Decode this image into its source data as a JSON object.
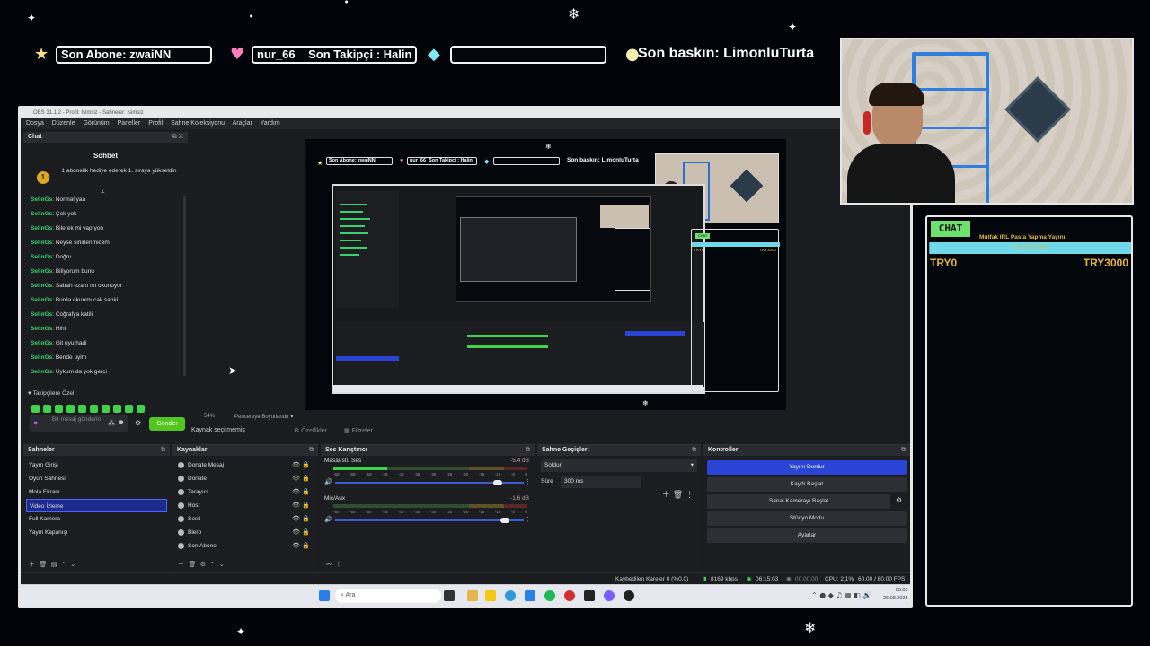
{
  "overlay": {
    "last_sub": "Son Abone: zwaiNN",
    "follower_prefix": "nur_66",
    "last_follower": "Son Takipçi : Halin",
    "empty_pill": "",
    "last_raid": "Son baskın: LimonluTurta"
  },
  "obs": {
    "title": "OBS 31.1.2 - Profil: İsimsiz - Sahneler: İsimsiz",
    "menu": [
      "Dosya",
      "Düzenle",
      "Görünüm",
      "Paneller",
      "Profil",
      "Sahne Koleksiyonu",
      "Araçlar",
      "Yardım"
    ],
    "chat_dock_title": "Chat",
    "chat_header": "Sohbet",
    "sub_banner": "1 abonelik hediye ederek 1. sıraya yükseldin",
    "chat_messages": [
      {
        "user": "SelinGs",
        "text": "Normal yaa"
      },
      {
        "user": "SelinGs",
        "text": "Çok yok"
      },
      {
        "user": "SelinGs",
        "text": "Bilerek mi yapıyon"
      },
      {
        "user": "SelinGs",
        "text": "Neyse sinirlenmicem"
      },
      {
        "user": "SelinGs",
        "text": "Doğru"
      },
      {
        "user": "SelinGs",
        "text": "Biliyorum bunu"
      },
      {
        "user": "SelinGs",
        "text": "Sabah ezanı mı okunuyor"
      },
      {
        "user": "SelinGs",
        "text": "Burda okunmucak sanki"
      },
      {
        "user": "SelinGs",
        "text": "Coğrafya katili"
      },
      {
        "user": "SelinGs",
        "text": "Hihii"
      },
      {
        "user": "SelinGs",
        "text": "Git uyu hadi"
      },
      {
        "user": "SelinGs",
        "text": "Bende uylm"
      },
      {
        "user": "SelinGs",
        "text": "Uykum da yok gerci"
      }
    ],
    "followers_only": "Takipçilere Özel",
    "message_placeholder": "Bir mesaj gönderin",
    "send_label": "Gönder",
    "zoom": "54%",
    "fit_label": "Pencereye Boyutlandır",
    "no_source": "Kaynak seçilmemiş",
    "properties": "Özellikler",
    "filters": "Filtreler",
    "scenes_title": "Sahneler",
    "scenes": [
      "Yayın Girişi",
      "Oyun Sahnesi",
      "Mola Ekranı",
      "Video İzleme",
      "Full Kamera",
      "Yayın Kapanışı"
    ],
    "selected_scene_index": 3,
    "sources_title": "Kaynaklar",
    "sources": [
      "Donate Mesaj",
      "Donate",
      "Tarayıcı",
      "Host",
      "Sesli",
      "Blerp",
      "Son Abone"
    ],
    "mixer_title": "Ses Karıştırıcı",
    "mixer": [
      {
        "name": "Masaüstü Ses",
        "db": "-5.4 dB",
        "level": 0.28,
        "volume": 0.86
      },
      {
        "name": "Mic/Aux",
        "db": "-1.6 dB",
        "level": 0.0,
        "volume": 0.9
      }
    ],
    "meter_ticks": [
      "-60",
      "-55",
      "-50",
      "-45",
      "-40",
      "-35",
      "-30",
      "-25",
      "-20",
      "-15",
      "-10",
      "-5",
      "0"
    ],
    "transitions_title": "Sahne Geçişleri",
    "transition": "Soldur",
    "duration_label": "Süre",
    "duration_value": "300 ms",
    "controls_title": "Kontroller",
    "controls": [
      "Yayını Durdur",
      "Kaydı Başlat",
      "Sanal Kamerayı Başlat",
      "Stüdyo Modu",
      "Ayarlar"
    ],
    "status": {
      "dropped": "Kaybedilen Kareler 0 (%0.0)",
      "bitrate": "8169 kbps",
      "stream_time": "06:15:03",
      "rec_time": "00:00:00",
      "cpu": "CPU: 2.1%",
      "fps": "60.00 / 60.00 FPS"
    }
  },
  "taskbar": {
    "search": "Ara",
    "time": "05:03",
    "date": "26.08.2025"
  },
  "chat_widget": {
    "label": "CHAT",
    "goal_title": "Mutfak IRL Pasta Yapma Yayını",
    "goal_progress": "17₺ (0.57%)",
    "goal_fraction": 0.0057,
    "min": "TRY0",
    "max": "TRY3000"
  },
  "colors": {
    "accent_green": "#36d36d",
    "send_button": "#53c51f",
    "primary_button": "#2a45d6",
    "goal_bar": "#6fd8e9",
    "goal_text": "#e6b43a"
  }
}
